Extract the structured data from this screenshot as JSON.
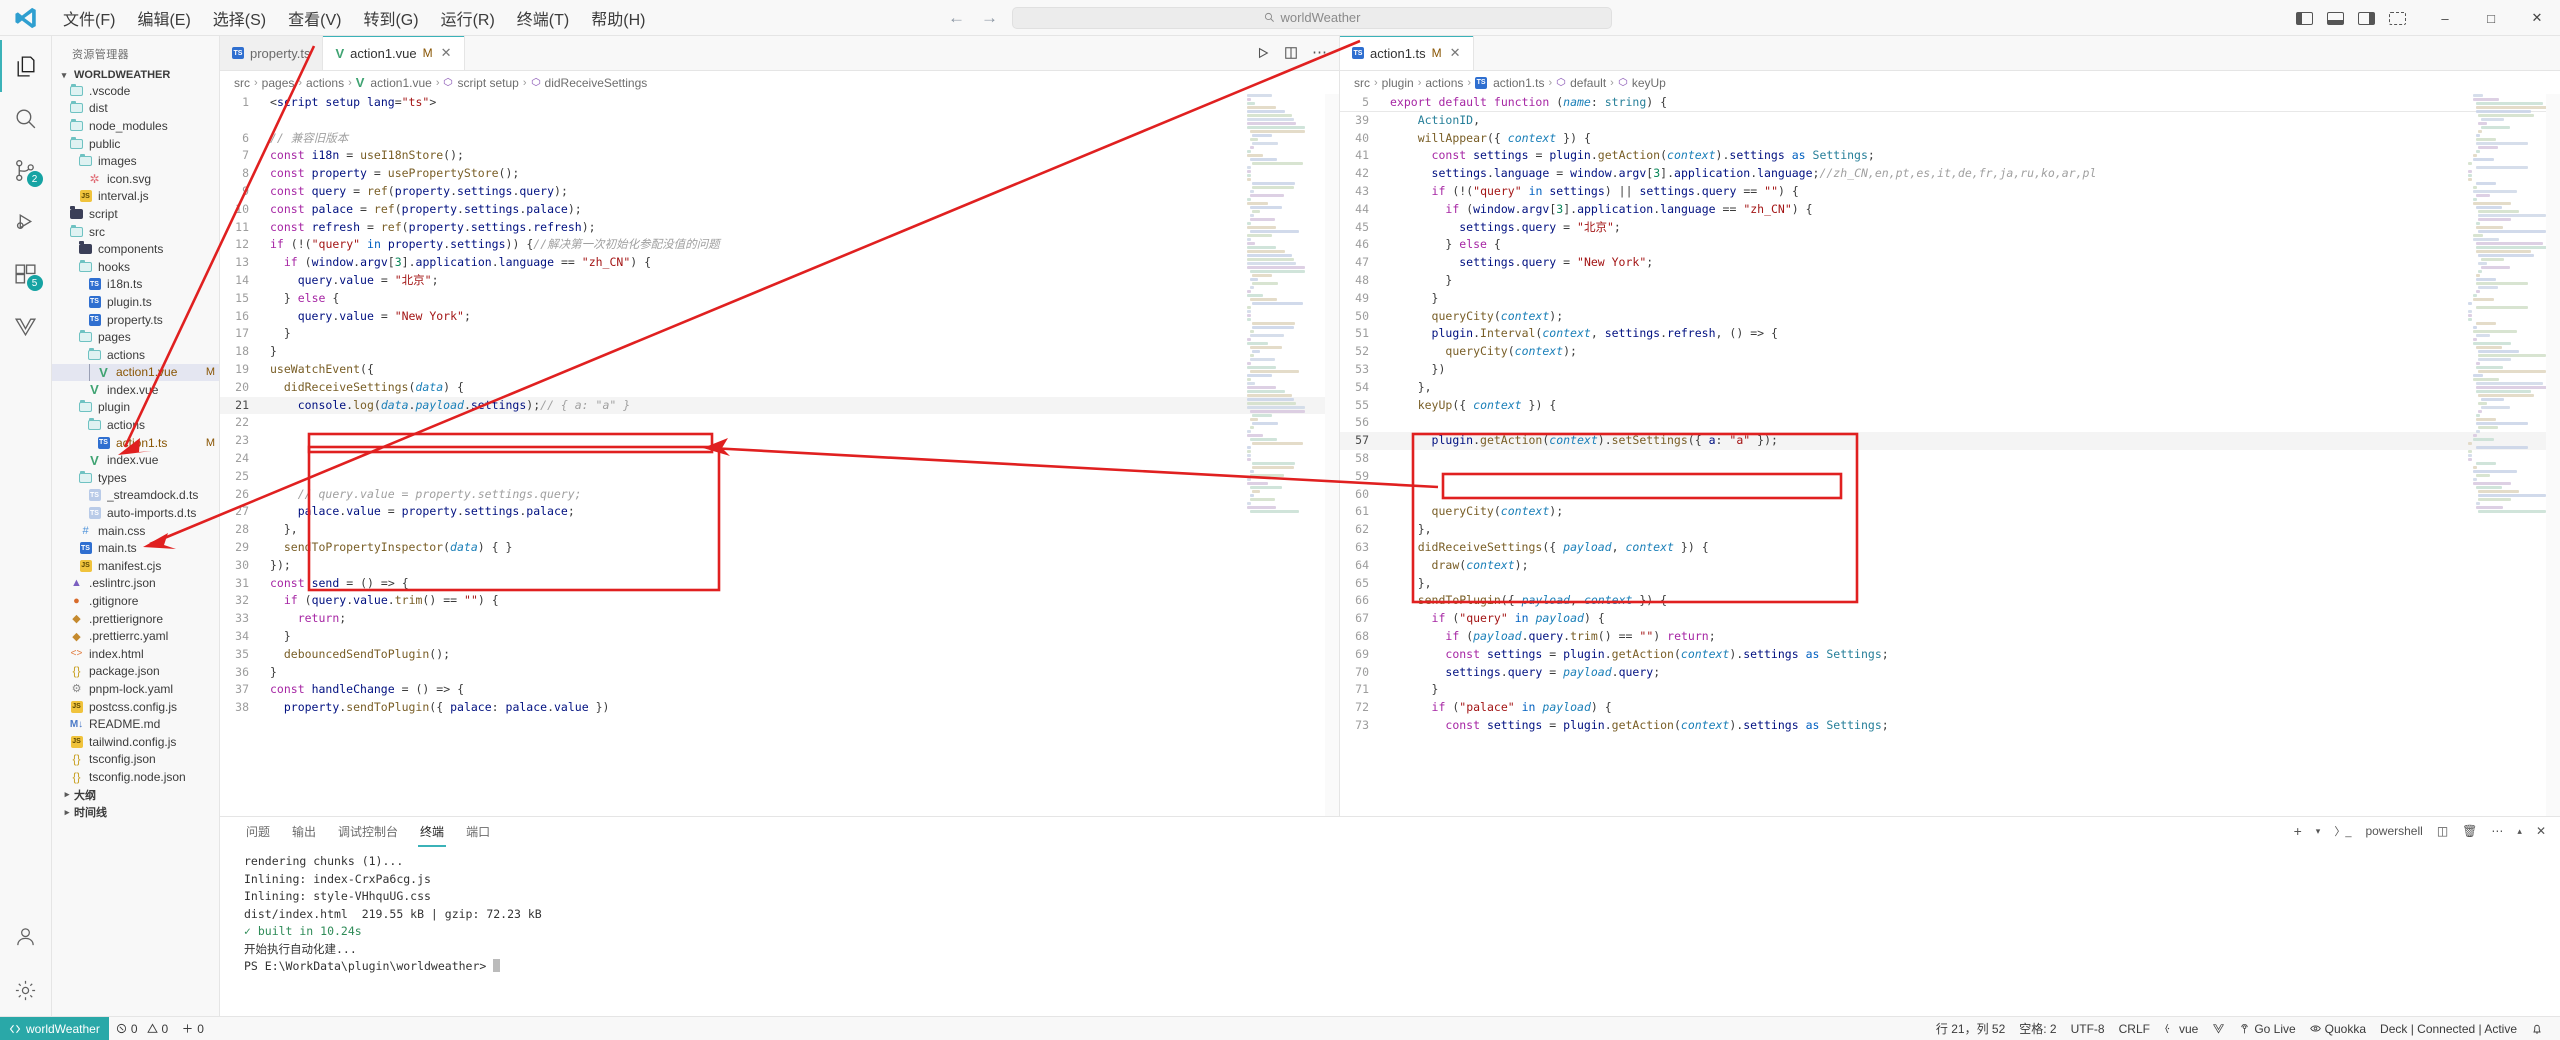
{
  "titlebar": {
    "logo": "vscode-logo",
    "menus": [
      "文件(F)",
      "编辑(E)",
      "选择(S)",
      "查看(V)",
      "转到(G)",
      "运行(R)",
      "终端(T)",
      "帮助(H)"
    ],
    "back": "←",
    "forward": "→",
    "search_icon": "search-icon",
    "search_text": "worldWeather",
    "window_buttons": [
      "—",
      "▢",
      "✕"
    ]
  },
  "activitybar": {
    "items": [
      {
        "name": "explorer",
        "icon": "files-icon",
        "badge": ""
      },
      {
        "name": "search",
        "icon": "search-icon",
        "badge": ""
      },
      {
        "name": "source-control",
        "icon": "source-control-icon",
        "badge": "2"
      },
      {
        "name": "run-and-debug",
        "icon": "debug-icon",
        "badge": ""
      },
      {
        "name": "extensions",
        "icon": "extensions-icon",
        "badge": "5"
      },
      {
        "name": "vue-tools",
        "icon": "vue-icon",
        "badge": ""
      }
    ],
    "bottom": [
      {
        "name": "accounts",
        "icon": "account-icon"
      },
      {
        "name": "settings",
        "icon": "gear-icon"
      }
    ]
  },
  "sidebar": {
    "title": "资源管理器",
    "root": "WORLDWEATHER",
    "tree": [
      {
        "label": ".vscode",
        "depth": 1,
        "icon": "folder-vscode",
        "mod": ""
      },
      {
        "label": "dist",
        "depth": 1,
        "icon": "folder-dist",
        "mod": ""
      },
      {
        "label": "node_modules",
        "depth": 1,
        "icon": "folder-node",
        "mod": ""
      },
      {
        "label": "public",
        "depth": 1,
        "icon": "folder-public",
        "mod": ""
      },
      {
        "label": "images",
        "depth": 2,
        "icon": "folder-images",
        "mod": ""
      },
      {
        "label": "icon.svg",
        "depth": 3,
        "icon": "svg-file",
        "mod": ""
      },
      {
        "label": "interval.js",
        "depth": 2,
        "icon": "js-file",
        "mod": ""
      },
      {
        "label": "script",
        "depth": 1,
        "icon": "folder-filled",
        "mod": ""
      },
      {
        "label": "src",
        "depth": 1,
        "icon": "folder-src",
        "mod": ""
      },
      {
        "label": "components",
        "depth": 2,
        "icon": "folder-filled",
        "mod": ""
      },
      {
        "label": "hooks",
        "depth": 2,
        "icon": "folder-open",
        "mod": ""
      },
      {
        "label": "i18n.ts",
        "depth": 3,
        "icon": "ts-file",
        "mod": ""
      },
      {
        "label": "plugin.ts",
        "depth": 3,
        "icon": "ts-file",
        "mod": ""
      },
      {
        "label": "property.ts",
        "depth": 3,
        "icon": "ts-file",
        "mod": ""
      },
      {
        "label": "pages",
        "depth": 2,
        "icon": "folder-open",
        "mod": ""
      },
      {
        "label": "actions",
        "depth": 3,
        "icon": "folder-open",
        "mod": ""
      },
      {
        "label": "action1.vue",
        "depth": 4,
        "icon": "vue-file",
        "mod": "M",
        "selected": true
      },
      {
        "label": "index.vue",
        "depth": 3,
        "icon": "vue-file",
        "mod": ""
      },
      {
        "label": "plugin",
        "depth": 2,
        "icon": "folder-open",
        "mod": ""
      },
      {
        "label": "actions",
        "depth": 3,
        "icon": "folder-open",
        "mod": ""
      },
      {
        "label": "action1.ts",
        "depth": 4,
        "icon": "ts-file",
        "mod": "M"
      },
      {
        "label": "index.vue",
        "depth": 3,
        "icon": "vue-file",
        "mod": ""
      },
      {
        "label": "types",
        "depth": 2,
        "icon": "folder-open",
        "mod": ""
      },
      {
        "label": "_streamdock.d.ts",
        "depth": 3,
        "icon": "ts-dim-file",
        "mod": ""
      },
      {
        "label": "auto-imports.d.ts",
        "depth": 3,
        "icon": "ts-dim-file",
        "mod": ""
      },
      {
        "label": "main.css",
        "depth": 2,
        "icon": "css-file",
        "mod": ""
      },
      {
        "label": "main.ts",
        "depth": 2,
        "icon": "ts-file",
        "mod": ""
      },
      {
        "label": "manifest.cjs",
        "depth": 2,
        "icon": "js-file",
        "mod": ""
      },
      {
        "label": ".eslintrc.json",
        "depth": 1,
        "icon": "eslint-file",
        "mod": ""
      },
      {
        "label": ".gitignore",
        "depth": 1,
        "icon": "git-file",
        "mod": ""
      },
      {
        "label": ".prettierignore",
        "depth": 1,
        "icon": "prettier-file",
        "mod": ""
      },
      {
        "label": ".prettierrc.yaml",
        "depth": 1,
        "icon": "prettier-file",
        "mod": ""
      },
      {
        "label": "index.html",
        "depth": 1,
        "icon": "html-file",
        "mod": ""
      },
      {
        "label": "package.json",
        "depth": 1,
        "icon": "json-file",
        "mod": ""
      },
      {
        "label": "pnpm-lock.yaml",
        "depth": 1,
        "icon": "yaml-file",
        "mod": ""
      },
      {
        "label": "postcss.config.js",
        "depth": 1,
        "icon": "js-file",
        "mod": ""
      },
      {
        "label": "README.md",
        "depth": 1,
        "icon": "md-file",
        "mod": ""
      },
      {
        "label": "tailwind.config.js",
        "depth": 1,
        "icon": "js-file",
        "mod": ""
      },
      {
        "label": "tsconfig.json",
        "depth": 1,
        "icon": "json-file",
        "mod": ""
      },
      {
        "label": "tsconfig.node.json",
        "depth": 1,
        "icon": "json-file",
        "mod": ""
      },
      {
        "label": "大纲",
        "depth": 0,
        "icon": "section",
        "mod": ""
      },
      {
        "label": "时间线",
        "depth": 0,
        "icon": "section",
        "mod": ""
      }
    ]
  },
  "left_editor": {
    "tabs": [
      {
        "label": "property.ts",
        "icon": "ts-file",
        "modified": "",
        "active": false
      },
      {
        "label": "action1.vue",
        "icon": "vue-file",
        "modified": "M",
        "active": true
      }
    ],
    "tab_actions": [
      "run-icon",
      "split-icon",
      "more-icon"
    ],
    "breadcrumbs": [
      "src",
      "pages",
      "actions",
      "action1.vue",
      "script setup",
      "didReceiveSettings"
    ],
    "lines": [
      {
        "n": "1",
        "text": "<script setup lang=\"ts\">"
      },
      {
        "n": "",
        "text": ""
      },
      {
        "n": "6",
        "text": "// 兼容旧版本"
      },
      {
        "n": "7",
        "text": "const i18n = useI18nStore();"
      },
      {
        "n": "8",
        "text": "const property = usePropertyStore();"
      },
      {
        "n": "9",
        "text": "const query = ref(property.settings.query);"
      },
      {
        "n": "10",
        "text": "const palace = ref(property.settings.palace);"
      },
      {
        "n": "11",
        "text": "const refresh = ref(property.settings.refresh);"
      },
      {
        "n": "12",
        "text": "if (!(\"query\" in property.settings)) {//解决第一次初始化参配没值的问题"
      },
      {
        "n": "13",
        "text": "  if (window.argv[3].application.language == \"zh_CN\") {"
      },
      {
        "n": "14",
        "text": "    query.value = \"北京\";"
      },
      {
        "n": "15",
        "text": "  } else {"
      },
      {
        "n": "16",
        "text": "    query.value = \"New York\";"
      },
      {
        "n": "17",
        "text": "  }"
      },
      {
        "n": "18",
        "text": "}"
      },
      {
        "n": "19",
        "text": "useWatchEvent({"
      },
      {
        "n": "20",
        "text": "  didReceiveSettings(data) {"
      },
      {
        "n": "21",
        "text": "    console.log(data.payload.settings);// { a: \"a\" }"
      },
      {
        "n": "22",
        "text": ""
      },
      {
        "n": "23",
        "text": ""
      },
      {
        "n": "24",
        "text": ""
      },
      {
        "n": "25",
        "text": ""
      },
      {
        "n": "26",
        "text": "    // query.value = property.settings.query;"
      },
      {
        "n": "27",
        "text": "    palace.value = property.settings.palace;"
      },
      {
        "n": "28",
        "text": "  },"
      },
      {
        "n": "29",
        "text": "  sendToPropertyInspector(data) { }"
      },
      {
        "n": "30",
        "text": "});"
      },
      {
        "n": "31",
        "text": "const send = () => {"
      },
      {
        "n": "32",
        "text": "  if (query.value.trim() == \"\") {"
      },
      {
        "n": "33",
        "text": "    return;"
      },
      {
        "n": "34",
        "text": "  }"
      },
      {
        "n": "35",
        "text": "  debouncedSendToPlugin();"
      },
      {
        "n": "36",
        "text": "}"
      },
      {
        "n": "37",
        "text": "const handleChange = () => {"
      },
      {
        "n": "38",
        "text": "  property.sendToPlugin({ palace: palace.value })"
      }
    ]
  },
  "right_editor": {
    "tabs": [
      {
        "label": "action1.ts",
        "icon": "ts-file",
        "modified": "M",
        "active": true
      }
    ],
    "breadcrumbs": [
      "src",
      "plugin",
      "actions",
      "action1.ts",
      "default",
      "keyUp"
    ],
    "sticky": {
      "n": "5",
      "text": "export default function (name: string) {"
    },
    "lines": [
      {
        "n": "39",
        "text": "    ActionID,"
      },
      {
        "n": "40",
        "text": "    willAppear({ context }) {"
      },
      {
        "n": "41",
        "text": "      const settings = plugin.getAction(context).settings as Settings;"
      },
      {
        "n": "42",
        "text": "      settings.language = window.argv[3].application.language;//zh_CN,en,pt,es,it,de,fr,ja,ru,ko,ar,pl"
      },
      {
        "n": "43",
        "text": "      if (!(\"query\" in settings) || settings.query == \"\") {"
      },
      {
        "n": "44",
        "text": "        if (window.argv[3].application.language == \"zh_CN\") {"
      },
      {
        "n": "45",
        "text": "          settings.query = \"北京\";"
      },
      {
        "n": "46",
        "text": "        } else {"
      },
      {
        "n": "47",
        "text": "          settings.query = \"New York\";"
      },
      {
        "n": "48",
        "text": "        }"
      },
      {
        "n": "49",
        "text": "      }"
      },
      {
        "n": "50",
        "text": "      queryCity(context);"
      },
      {
        "n": "51",
        "text": "      plugin.Interval(context, settings.refresh, () => {"
      },
      {
        "n": "52",
        "text": "        queryCity(context);"
      },
      {
        "n": "53",
        "text": "      })"
      },
      {
        "n": "54",
        "text": "    },"
      },
      {
        "n": "55",
        "text": "    keyUp({ context }) {"
      },
      {
        "n": "56",
        "text": ""
      },
      {
        "n": "57",
        "text": "      plugin.getAction(context).setSettings({ a: \"a\" });"
      },
      {
        "n": "58",
        "text": ""
      },
      {
        "n": "59",
        "text": ""
      },
      {
        "n": "60",
        "text": ""
      },
      {
        "n": "61",
        "text": "      queryCity(context);"
      },
      {
        "n": "62",
        "text": "    },"
      },
      {
        "n": "63",
        "text": "    didReceiveSettings({ payload, context }) {"
      },
      {
        "n": "64",
        "text": "      draw(context);"
      },
      {
        "n": "65",
        "text": "    },"
      },
      {
        "n": "66",
        "text": "    sendToPlugin({ payload, context }) {"
      },
      {
        "n": "67",
        "text": "      if (\"query\" in payload) {"
      },
      {
        "n": "68",
        "text": "        if (payload.query.trim() == \"\") return;"
      },
      {
        "n": "69",
        "text": "        const settings = plugin.getAction(context).settings as Settings;"
      },
      {
        "n": "70",
        "text": "        settings.query = payload.query;"
      },
      {
        "n": "71",
        "text": "      }"
      },
      {
        "n": "72",
        "text": "      if (\"palace\" in payload) {"
      },
      {
        "n": "73",
        "text": "        const settings = plugin.getAction(context).settings as Settings;"
      }
    ]
  },
  "panel": {
    "tabs": [
      "问题",
      "输出",
      "调试控制台",
      "终端",
      "端口"
    ],
    "active_tab": "终端",
    "shell": "powershell",
    "actions": [
      "add-icon",
      "chevron-down-icon",
      "split-icon",
      "trash-icon",
      "more-icon",
      "chevron-up-icon",
      "close-icon"
    ],
    "terminal_lines": [
      "rendering chunks (1)...",
      "",
      "Inlining: index-CrxPa6cg.js",
      "Inlining: style-VHhquUG.css",
      "dist/index.html  219.55 kB | gzip: 72.23 kB",
      "✓ built in 10.24s",
      "开始执行自动化建...",
      "PS E:\\WorkData\\plugin\\worldweather> "
    ]
  },
  "statusbar": {
    "remote": "worldWeather",
    "errors": "0",
    "warnings": "0",
    "ports": "0",
    "cursor": "行 21，列 52",
    "spaces": "空格: 2",
    "encoding": "UTF-8",
    "eol": "CRLF",
    "language": "vue",
    "vue_icon": "vue-icon",
    "golive": "Go Live",
    "quokka": "Quokka",
    "deck": "Deck | Connected | Active",
    "bell": "bell-icon"
  },
  "colors": {
    "accent": "#3bb2b8",
    "remote_bg": "#2aa8a8",
    "annotation": "#e02020",
    "selection": "#e4e6f1"
  }
}
